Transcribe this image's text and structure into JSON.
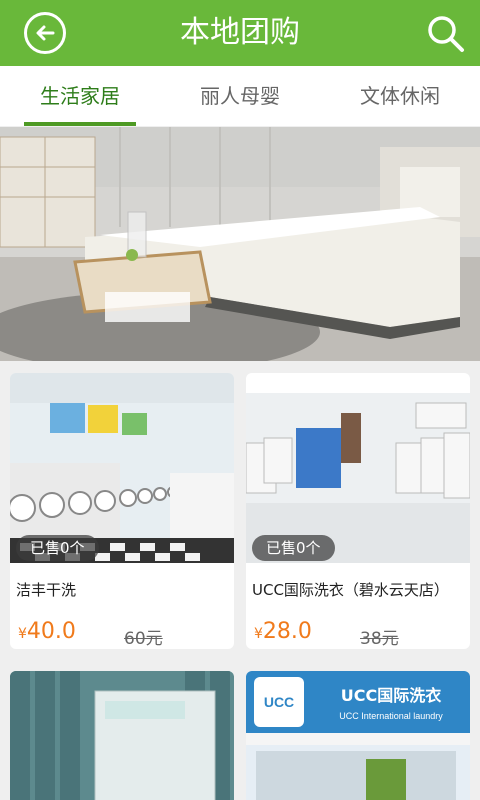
{
  "header": {
    "title": "本地团购"
  },
  "tabs": [
    {
      "label": "生活家居",
      "active": true
    },
    {
      "label": "丽人母婴",
      "active": false
    },
    {
      "label": "文体休闲",
      "active": false
    }
  ],
  "deals": [
    {
      "name": "洁丰干洗",
      "sold": "已售0个",
      "currency": "¥",
      "price": "40.0",
      "original": "60元"
    },
    {
      "name": "UCC国际洗衣（碧水云天店）",
      "sold": "已售0个",
      "currency": "¥",
      "price": "28.0",
      "original": "38元"
    }
  ],
  "store_signs": {
    "brand_logo": "UCC",
    "store_sign_name": "UCC国际洗衣",
    "store_sign_sub": "UCC International laundry"
  },
  "colors": {
    "brand_green": "#69b83a",
    "active_tab": "#2e7d1a",
    "price_orange": "#f07a1b"
  }
}
